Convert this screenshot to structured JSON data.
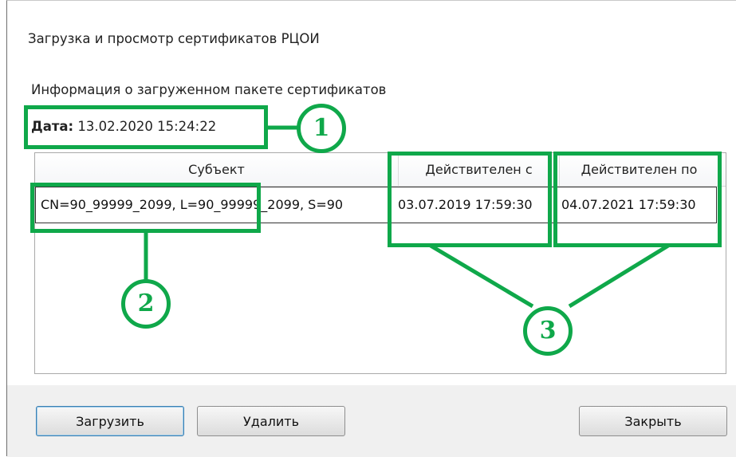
{
  "window": {
    "title": "Загрузка и просмотр сертификатов РЦОИ"
  },
  "info": {
    "label": "Информация о загруженном пакете сертификатов",
    "date_label": "Дата:",
    "date_value": "13.02.2020 15:24:22"
  },
  "grid": {
    "columns": [
      "Субъект",
      "Действителен с",
      "Действителен по"
    ],
    "rows": [
      {
        "subject": "CN=90_99999_2099, L=90_99999_2099, S=90",
        "valid_from": "03.07.2019 17:59:30",
        "valid_to": "04.07.2021 17:59:30"
      }
    ]
  },
  "buttons": {
    "load": "Загрузить",
    "delete": "Удалить",
    "close": "Закрыть"
  },
  "callouts": [
    "1",
    "2",
    "3"
  ],
  "colors": {
    "callout": "#0fa84a",
    "default_button_border": "#3c7fb1"
  }
}
